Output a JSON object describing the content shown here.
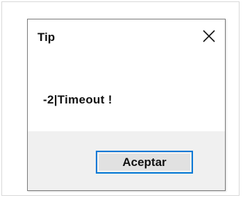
{
  "dialog": {
    "title": "Tip",
    "close_icon": "close-icon",
    "message": "-2|Timeout !",
    "ok_label": "Aceptar"
  },
  "colors": {
    "button_focus_border": "#0078d7",
    "footer_background": "#f0f0f0"
  }
}
